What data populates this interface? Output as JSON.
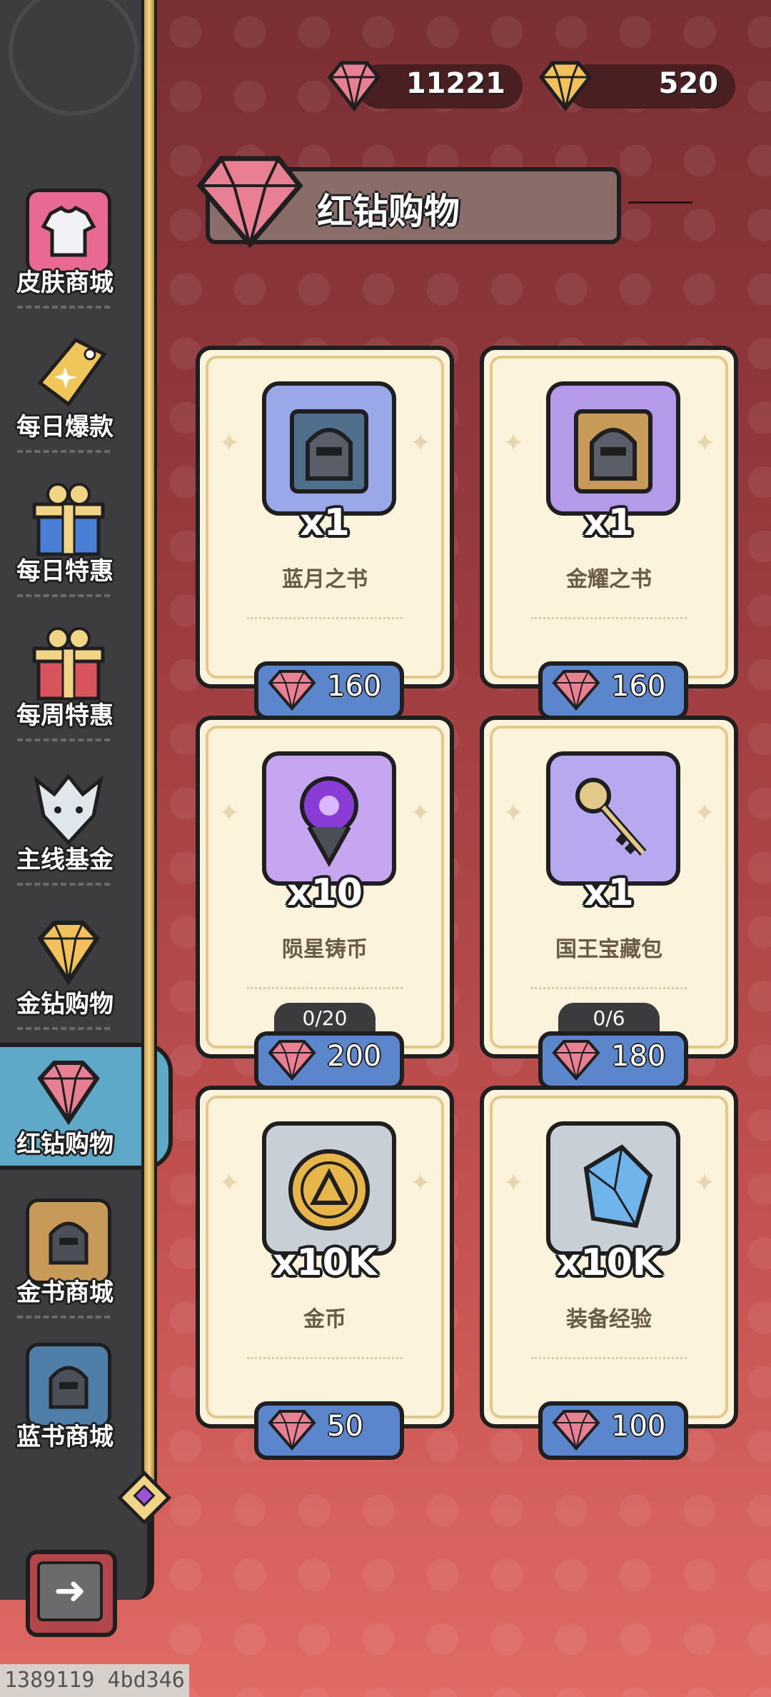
{
  "currency": {
    "red_gems": "11221",
    "gold_gems": "520"
  },
  "sidebar": {
    "items": [
      {
        "label": "皮肤商城",
        "icon": "shirt-icon"
      },
      {
        "label": "每日爆款",
        "icon": "price-tag-icon"
      },
      {
        "label": "每日特惠",
        "icon": "gift-box-blue-icon"
      },
      {
        "label": "每周特惠",
        "icon": "gift-box-red-icon"
      },
      {
        "label": "主线基金",
        "icon": "wolf-head-icon"
      },
      {
        "label": "金钻购物",
        "icon": "gold-diamond-icon"
      },
      {
        "label": "红钻购物",
        "icon": "red-diamond-icon"
      },
      {
        "label": "金书商城",
        "icon": "gold-book-icon"
      },
      {
        "label": "蓝书商城",
        "icon": "blue-book-icon"
      }
    ],
    "active_index": 6
  },
  "header": {
    "title": "红钻购物"
  },
  "shop": {
    "items": [
      {
        "name": "蓝月之书",
        "qty": "x1",
        "price": "160",
        "limit": "",
        "icon": "blue-moon-book-icon"
      },
      {
        "name": "金耀之书",
        "qty": "x1",
        "price": "160",
        "limit": "",
        "icon": "gold-book-icon"
      },
      {
        "name": "陨星铸币",
        "qty": "x10",
        "price": "200",
        "limit": "0/20",
        "icon": "meteor-coin-icon"
      },
      {
        "name": "国王宝藏包",
        "qty": "x1",
        "price": "180",
        "limit": "0/6",
        "icon": "key-icon"
      },
      {
        "name": "金币",
        "qty": "x10K",
        "price": "50",
        "limit": "",
        "icon": "gold-coin-icon"
      },
      {
        "name": "装备经验",
        "qty": "x10K",
        "price": "100",
        "limit": "",
        "icon": "crystal-icon"
      }
    ]
  },
  "footer": {
    "watermark": "1389119 4bd346"
  },
  "colors": {
    "red_gem": "#e87f93",
    "gold_gem": "#f1c15b",
    "price_button": "#5b86cc",
    "card_bg": "#fbf3dc",
    "sidebar_bg": "#3d3d3f"
  }
}
